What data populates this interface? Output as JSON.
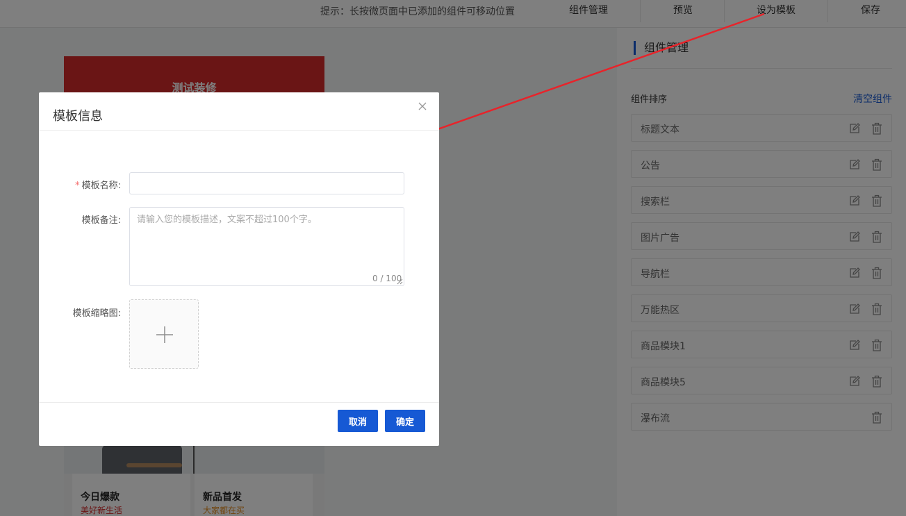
{
  "topbar": {
    "hint": "提示：长按微页面中已添加的组件可移动位置",
    "buttons": [
      "组件管理",
      "预览",
      "设为模板",
      "保存"
    ]
  },
  "phone": {
    "shop_title": "测试装修",
    "cards": [
      {
        "title": "今日爆款",
        "subtitle": "美好新生活",
        "subtitle_color": "#d42a2a"
      },
      {
        "title": "新品首发",
        "subtitle": "大家都在买",
        "subtitle_color": "#e08a1e"
      }
    ]
  },
  "panel": {
    "title": "组件管理",
    "sort_label": "组件排序",
    "clear_label": "清空组件",
    "components": [
      {
        "label": "标题文本",
        "editable": true
      },
      {
        "label": "公告",
        "editable": true
      },
      {
        "label": "搜索栏",
        "editable": true
      },
      {
        "label": "图片广告",
        "editable": true
      },
      {
        "label": "导航栏",
        "editable": true
      },
      {
        "label": "万能热区",
        "editable": true
      },
      {
        "label": "商品模块1",
        "editable": true
      },
      {
        "label": "商品模块5",
        "editable": true
      },
      {
        "label": "瀑布流",
        "editable": false
      }
    ]
  },
  "dialog": {
    "title": "模板信息",
    "name_label": "模板名称:",
    "name_value": "",
    "remark_label": "模板备注:",
    "remark_placeholder": "请输入您的模板描述，文案不超过100个字。",
    "remark_counter": "0 / 100",
    "thumb_label": "模板缩略图:",
    "cancel_label": "取消",
    "confirm_label": "确定"
  },
  "colors": {
    "accent": "#1659d4",
    "brand_red": "#d42a2a",
    "required": "#f56c6c",
    "annotation": "#e8232a"
  },
  "icons": [
    "edit-icon",
    "trash-icon",
    "close-icon",
    "plus-icon"
  ]
}
